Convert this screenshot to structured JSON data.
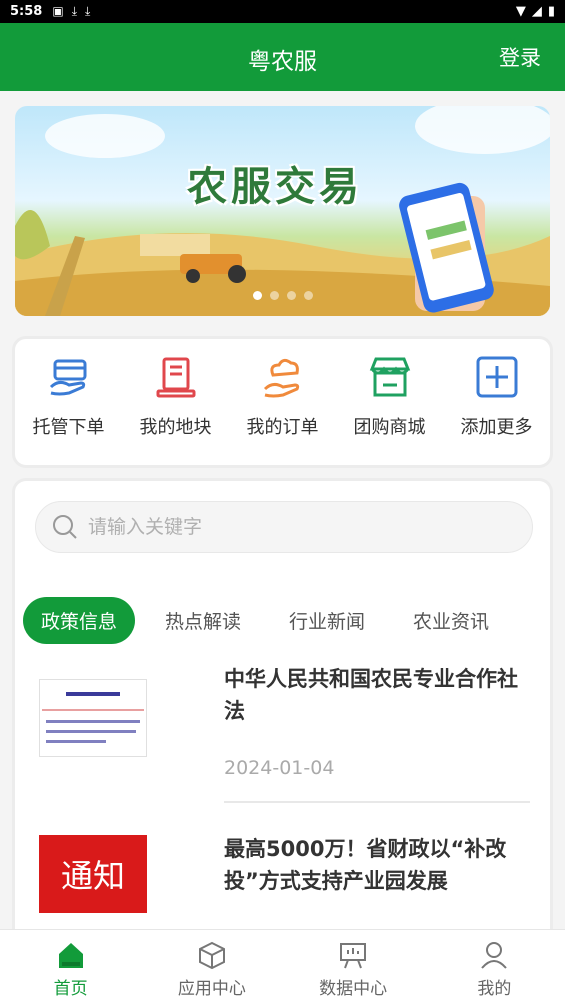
{
  "status_bar": {
    "time": "5:58"
  },
  "header": {
    "title": "粤农服",
    "login": "登录"
  },
  "banner": {
    "text": "农服交易"
  },
  "quick_actions": [
    {
      "label": "托管下单",
      "icon": "handshake-card-icon",
      "color": "#3a7bd5"
    },
    {
      "label": "我的地块",
      "icon": "document-icon",
      "color": "#e0474c"
    },
    {
      "label": "我的订单",
      "icon": "cloud-hand-icon",
      "color": "#f08a3c"
    },
    {
      "label": "团购商城",
      "icon": "shop-icon",
      "color": "#1fa160"
    },
    {
      "label": "添加更多",
      "icon": "plus-square-icon",
      "color": "#3a7bd5"
    }
  ],
  "search": {
    "placeholder": "请输入关键字"
  },
  "tabs": [
    {
      "label": "政策信息",
      "active": true
    },
    {
      "label": "热点解读",
      "active": false
    },
    {
      "label": "行业新闻",
      "active": false
    },
    {
      "label": "农业资讯",
      "active": false
    }
  ],
  "articles": [
    {
      "title": "中华人民共和国农民专业合作社法",
      "date": "2024-01-04"
    },
    {
      "title": "最高5000万！省财政以“补改投”方式支持产业园发展",
      "thumb_text": "通知"
    }
  ],
  "bottom_nav": [
    {
      "label": "首页",
      "icon": "home-icon",
      "active": true
    },
    {
      "label": "应用中心",
      "icon": "cube-icon",
      "active": false
    },
    {
      "label": "数据中心",
      "icon": "presentation-board-icon",
      "active": false
    },
    {
      "label": "我的",
      "icon": "user-icon",
      "active": false
    }
  ],
  "colors": {
    "primary": "#129b3a"
  }
}
